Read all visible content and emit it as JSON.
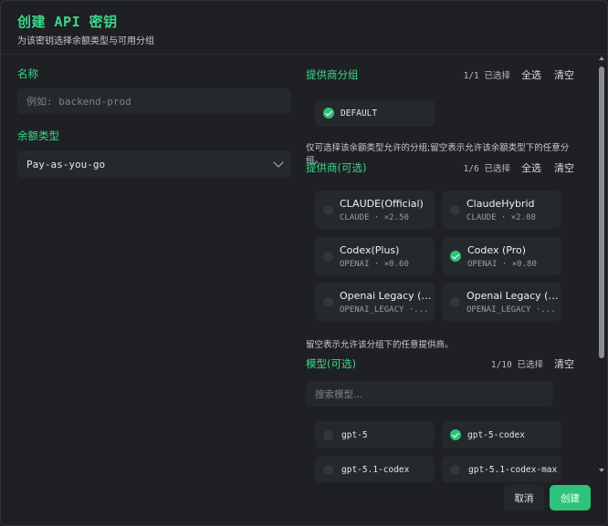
{
  "dialog": {
    "title": "创建 API 密钥",
    "subtitle": "为该密钥选择余额类型与可用分组"
  },
  "name_field": {
    "label": "名称",
    "placeholder": "例如: backend-prod"
  },
  "balance_type": {
    "label": "余额类型",
    "value": "Pay-as-you-go"
  },
  "provider_groups": {
    "title": "提供商分组",
    "count": "1/1",
    "count_suffix": "已选择",
    "select_all": "全选",
    "clear": "清空",
    "items": [
      {
        "name": "DEFAULT",
        "checked": true
      }
    ],
    "hint": "仅可选择该余额类型允许的分组;留空表示允许该余额类型下的任意分组。"
  },
  "providers": {
    "title": "提供商(可选)",
    "count": "1/6",
    "count_suffix": "已选择",
    "select_all": "全选",
    "clear": "清空",
    "items": [
      {
        "name": "CLAUDE(Official)",
        "sub": "CLAUDE · ×2.50",
        "checked": false
      },
      {
        "name": "ClaudeHybrid",
        "sub": "CLAUDE · ×2.08",
        "checked": false
      },
      {
        "name": "Codex(Plus)",
        "sub": "OPENAI · ×0.60",
        "checked": false
      },
      {
        "name": "Codex (Pro)",
        "sub": "OPENAI · ×0.80",
        "checked": true
      },
      {
        "name": "Openai Legacy (P...",
        "sub": "OPENAI_LEGACY ·...",
        "checked": false
      },
      {
        "name": "Openai Legacy (P...",
        "sub": "OPENAI_LEGACY ·...",
        "checked": false
      }
    ],
    "hint": "留空表示允许该分组下的任意提供商。"
  },
  "models": {
    "title": "模型(可选)",
    "count": "1/10",
    "count_suffix": "已选择",
    "clear": "清空",
    "search_placeholder": "搜索模型...",
    "items": [
      {
        "name": "gpt-5",
        "checked": false
      },
      {
        "name": "gpt-5-codex",
        "checked": true
      },
      {
        "name": "gpt-5.1-codex",
        "checked": false
      },
      {
        "name": "gpt-5.1-codex-max",
        "checked": false
      }
    ]
  },
  "footer": {
    "cancel": "取消",
    "create": "创建"
  },
  "colors": {
    "accent": "#3dd68c",
    "button_green": "#2fc27a",
    "background": "#1e2023",
    "surface": "#25282c"
  }
}
